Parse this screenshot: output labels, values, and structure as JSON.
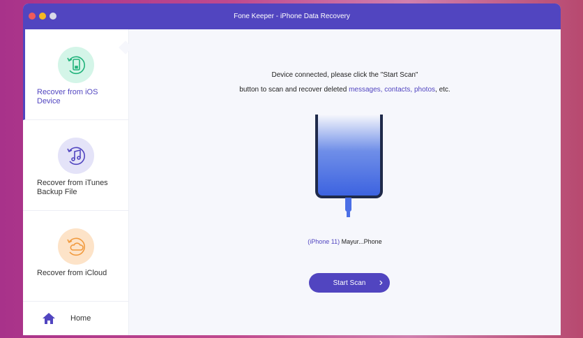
{
  "window": {
    "title": "Fone Keeper - iPhone Data Recovery",
    "colors": {
      "accent": "#5145c0",
      "close": "#f15b5b",
      "minimize": "#f4b722",
      "zoom": "#d9d9e8"
    }
  },
  "sidebar": {
    "items": [
      {
        "label": "Recover from iOS Device",
        "icon": "phone-restore-icon",
        "active": true
      },
      {
        "label": "Recover from iTunes Backup File",
        "icon": "music-restore-icon"
      },
      {
        "label": "Recover from iCloud",
        "icon": "cloud-restore-icon"
      }
    ],
    "home": {
      "label": "Home",
      "icon": "home-icon"
    }
  },
  "main": {
    "line1": "Device connected, please click the \"Start Scan\"",
    "line2_prefix": "button to scan and recover deleted ",
    "line2_links": "messages, contacts, photos",
    "line2_suffix": ", etc.",
    "device_model": "(iPhone 11)",
    "device_name": " Mayur...Phone",
    "start_scan": "Start Scan"
  }
}
